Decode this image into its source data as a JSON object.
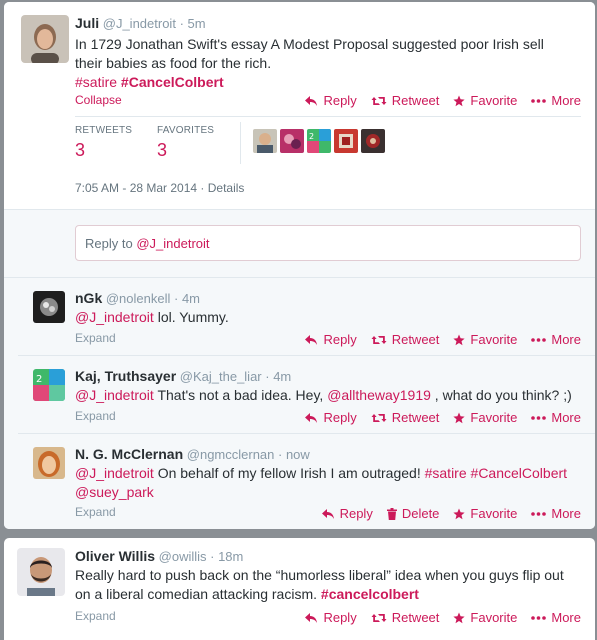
{
  "main_tweet": {
    "name": "Juli",
    "handle": "@J_indetroit",
    "time": "· 5m",
    "text_line1": "In 1729 Jonathan Swift's essay A Modest Proposal suggested poor Irish sell",
    "text_line2": "their babies as food for the rich.",
    "hashtag1": "#satire",
    "hashtag2": "#CancelColbert",
    "collapse": "Collapse",
    "retweets_label": "RETWEETS",
    "retweets_count": "3",
    "favorites_label": "FAVORITES",
    "favorites_count": "3",
    "timestamp": "7:05 AM - 28 Mar 2014 · Details",
    "reply_box_prefix": "Reply to",
    "reply_box_handle": "@J_indetroit"
  },
  "actions": {
    "reply": "Reply",
    "retweet": "Retweet",
    "favorite": "Favorite",
    "more": "More",
    "delete": "Delete",
    "expand": "Expand"
  },
  "replies": [
    {
      "name": "nGk",
      "handle": "@nolenkell",
      "time": "· 4m",
      "mention": "@J_indetroit",
      "text": " lol. Yummy."
    },
    {
      "name": "Kaj, Truthsayer",
      "handle": "@Kaj_the_liar",
      "time": "· 4m",
      "mention": "@J_indetroit",
      "text_a": " That's not a bad idea. Hey, ",
      "mention2": "@alltheway1919",
      "text_b": " , what do you think? ;)"
    },
    {
      "name": "N. G. McClernan",
      "handle": "@ngmcclernan",
      "time": "· now",
      "mention": "@J_indetroit",
      "text_a": " On behalf of my fellow Irish I am outraged! ",
      "hashtag1": "#satire",
      "hashtag2": "#CancelColbert",
      "mention2": "@suey_park"
    }
  ],
  "second_tweet": {
    "name": "Oliver Willis",
    "handle": "@owillis",
    "time": "· 18m",
    "line1": "Really hard to push back on the “humorless liberal” idea when you guys flip out",
    "line2_a": "on a liberal comedian attacking racism. ",
    "hashtag": "#cancelcolbert"
  },
  "colors": {
    "accent": "#cc1a5a",
    "muted": "#8899a6",
    "background": "#8a8f94"
  }
}
